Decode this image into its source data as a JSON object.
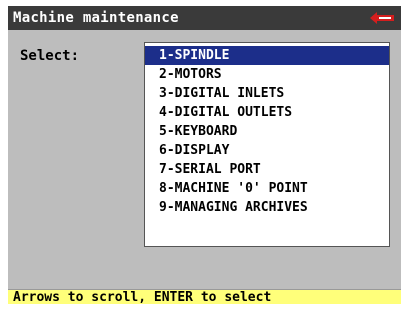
{
  "window": {
    "title": "Machine maintenance",
    "logo_icon": "red-key-logo-icon"
  },
  "main": {
    "select_label": "Select:",
    "menu_items": [
      {
        "label": "1-SPINDLE",
        "selected": true
      },
      {
        "label": "2-MOTORS",
        "selected": false
      },
      {
        "label": "3-DIGITAL INLETS",
        "selected": false
      },
      {
        "label": "4-DIGITAL OUTLETS",
        "selected": false
      },
      {
        "label": "5-KEYBOARD",
        "selected": false
      },
      {
        "label": "6-DISPLAY",
        "selected": false
      },
      {
        "label": "7-SERIAL PORT",
        "selected": false
      },
      {
        "label": "8-MACHINE '0' POINT",
        "selected": false
      },
      {
        "label": "9-MANAGING ARCHIVES",
        "selected": false
      }
    ]
  },
  "status": {
    "hint": "Arrows to scroll, ENTER to select"
  },
  "colors": {
    "titlebar": "#3a3a3a",
    "background": "#bdbdbd",
    "selection": "#1c2e8a",
    "statusbar": "#ffff7a",
    "logo": "#d41e1e"
  }
}
